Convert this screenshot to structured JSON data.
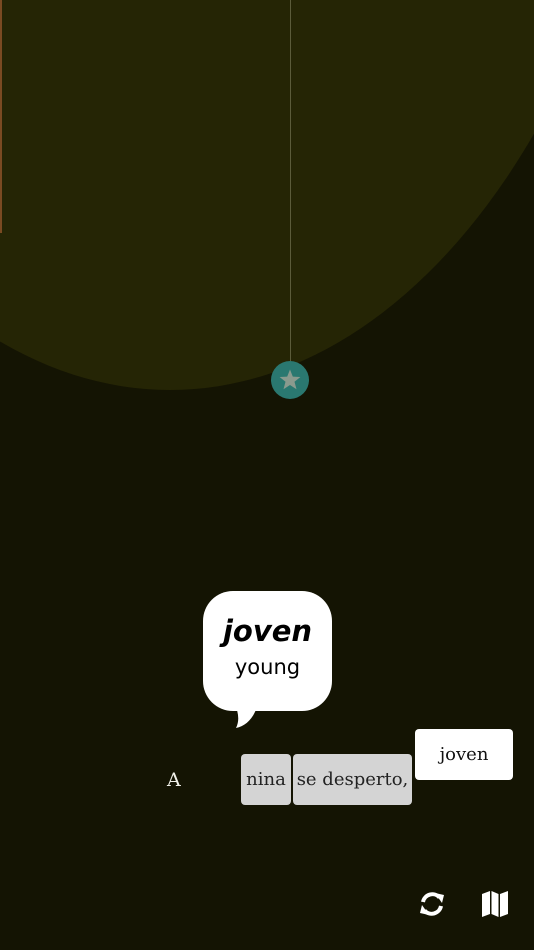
{
  "scene": {
    "colors": {
      "background": "#141403",
      "sky": "#252505",
      "node": "#2a7870",
      "node_star": "#8a9a8e"
    },
    "node_icon": "star-icon"
  },
  "bubble": {
    "word": "joven",
    "translation": "young"
  },
  "sentence": {
    "lead_word": "A",
    "filled_tiles": [
      "nina",
      "se desperto,"
    ]
  },
  "choices": [
    "joven"
  ],
  "toolbar": {
    "refresh_icon": "refresh-icon",
    "map_icon": "map-icon"
  }
}
